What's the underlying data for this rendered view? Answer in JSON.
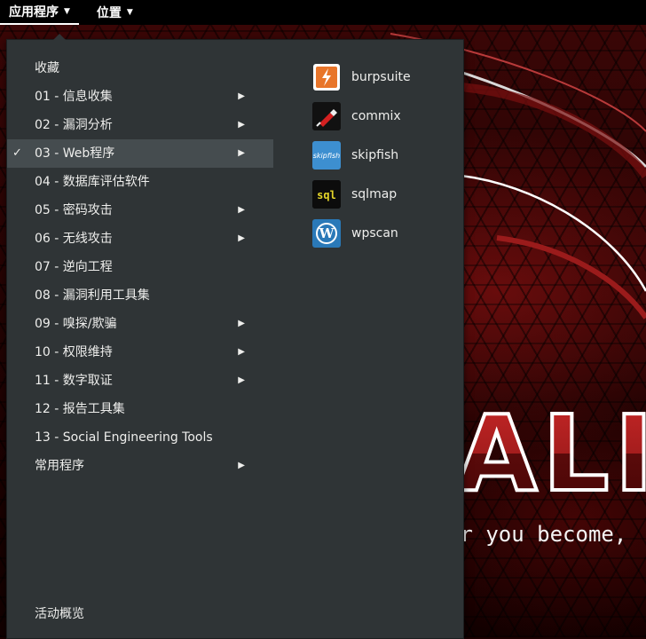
{
  "top_panel": {
    "applications_label": "应用程序",
    "places_label": "位置"
  },
  "menu": {
    "categories": [
      {
        "label": "收藏",
        "has_submenu": false,
        "selected": false
      },
      {
        "label": "01 - 信息收集",
        "has_submenu": true,
        "selected": false
      },
      {
        "label": "02 - 漏洞分析",
        "has_submenu": true,
        "selected": false
      },
      {
        "label": "03 - Web程序",
        "has_submenu": true,
        "selected": true
      },
      {
        "label": "04 - 数据库评估软件",
        "has_submenu": false,
        "selected": false
      },
      {
        "label": "05 - 密码攻击",
        "has_submenu": true,
        "selected": false
      },
      {
        "label": "06 - 无线攻击",
        "has_submenu": true,
        "selected": false
      },
      {
        "label": "07 - 逆向工程",
        "has_submenu": false,
        "selected": false
      },
      {
        "label": "08 - 漏洞利用工具集",
        "has_submenu": false,
        "selected": false
      },
      {
        "label": "09 - 嗅探/欺骗",
        "has_submenu": true,
        "selected": false
      },
      {
        "label": "10 - 权限维持",
        "has_submenu": true,
        "selected": false
      },
      {
        "label": "11 - 数字取证",
        "has_submenu": true,
        "selected": false
      },
      {
        "label": "12 - 报告工具集",
        "has_submenu": false,
        "selected": false
      },
      {
        "label": "13 - Social Engineering Tools",
        "has_submenu": false,
        "selected": false
      },
      {
        "label": "常用程序",
        "has_submenu": true,
        "selected": false
      }
    ],
    "check_glyph": "✓",
    "arrow_glyph": "▶",
    "activities_label": "活动概览",
    "apps": [
      {
        "label": "burpsuite",
        "icon": "burpsuite-icon",
        "icon_text": "",
        "color": "#e8752a"
      },
      {
        "label": "commix",
        "icon": "commix-icon",
        "icon_text": "",
        "color": "#111111"
      },
      {
        "label": "skipfish",
        "icon": "skipfish-icon",
        "icon_text": "skipfish",
        "color": "#3d8fd0"
      },
      {
        "label": "sqlmap",
        "icon": "sqlmap-icon",
        "icon_text": "sql",
        "color": "#0c0c0c"
      },
      {
        "label": "wpscan",
        "icon": "wordpress-icon",
        "icon_text": "W",
        "color": "#2a79b8"
      }
    ]
  },
  "wallpaper": {
    "logo_text": "ALI",
    "slogan": "er you become,"
  },
  "colors": {
    "menu_bg": "#2f3436",
    "selected_bg": "#454c4f",
    "panel_bg": "#000000",
    "text": "#eeeeec"
  }
}
